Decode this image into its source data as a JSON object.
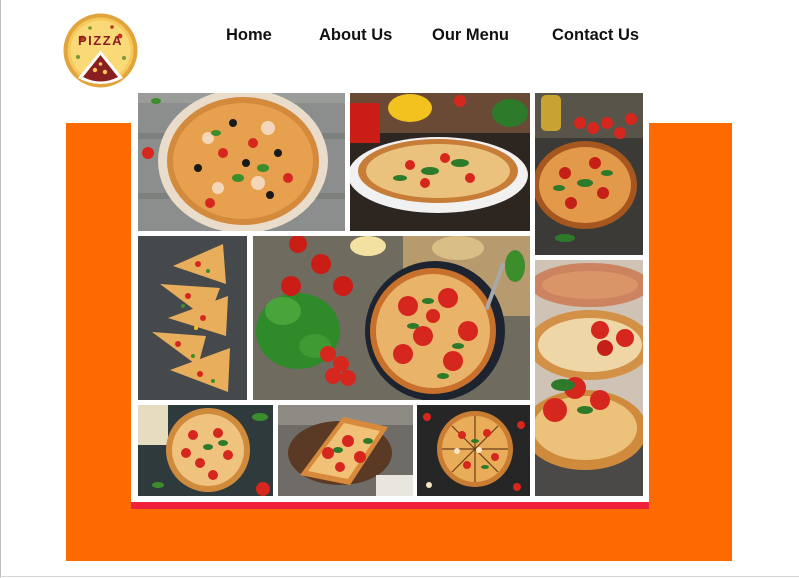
{
  "logo": {
    "text": "PIZZA",
    "icon": "pizza-logo-icon"
  },
  "nav": {
    "items": [
      {
        "label": "Home"
      },
      {
        "label": "About Us"
      },
      {
        "label": "Our Menu"
      },
      {
        "label": "Contact Us"
      }
    ]
  },
  "gallery": {
    "tiles": [
      {
        "icon": "pizza-olives-photo"
      },
      {
        "icon": "pizza-plate-photo"
      },
      {
        "icon": "pizza-tomatoes-photo"
      },
      {
        "icon": "pizza-slices-photo"
      },
      {
        "icon": "pizza-pan-basil-photo"
      },
      {
        "icon": "pizza-closeup-photo"
      },
      {
        "icon": "pizza-board-photo"
      },
      {
        "icon": "pizza-half-photo"
      },
      {
        "icon": "pizza-cut-photo"
      }
    ]
  },
  "colors": {
    "accent_orange": "#ff6a00",
    "accent_red": "#f0203a",
    "text": "#111111"
  }
}
